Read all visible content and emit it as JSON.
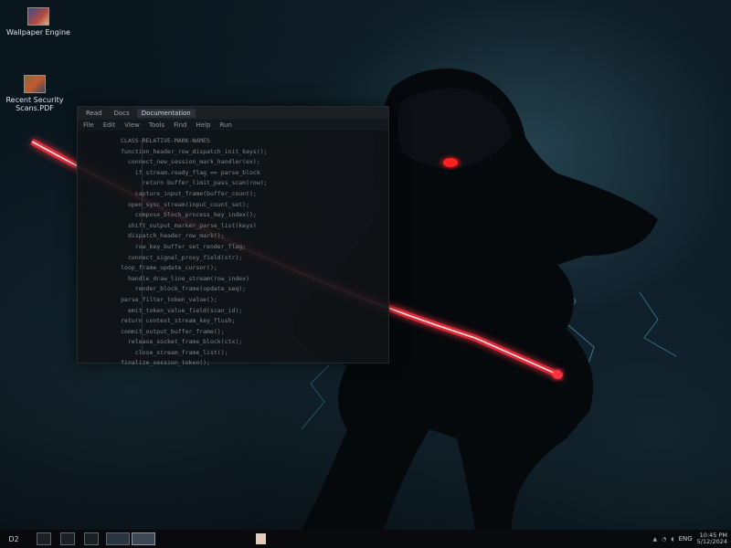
{
  "desktop": {
    "icons": [
      {
        "label": "Wallpaper Engine",
        "icon": "app-icon"
      },
      {
        "label": "Recent Security Scans.PDF",
        "icon": "pdf-icon"
      }
    ]
  },
  "window": {
    "tabs": [
      {
        "label": "Read"
      },
      {
        "label": "Docs"
      },
      {
        "label": "Documentation"
      }
    ],
    "menu": [
      {
        "label": "File"
      },
      {
        "label": "Edit"
      },
      {
        "label": "View"
      },
      {
        "label": "Tools"
      },
      {
        "label": "Find"
      },
      {
        "label": "Help"
      },
      {
        "label": "Run"
      }
    ],
    "code_lines": [
      "          CLASS-RELATIVE-MARK-NAMES",
      "          function_header_row_dispatch_init_keys();",
      "            connect_new_session_mark_handler(ex);",
      "              if stream.ready_flag == parse_block",
      "                return buffer_limit_pass_scan(row);",
      "              capture_input_frame(buffer_count);",
      "            open_sync_stream(input_count_set);",
      "              compose_block_process_key_index();",
      "            shift_output_marker_parse_list(keys)",
      "            dispatch_header_row_mark();",
      "              row_key_buffer_set_render_flag;",
      "            connect_signal_proxy_field(str);",
      "          loop_frame_update_cursor();",
      "            handle_draw_line_stream(row_index)",
      "              render_block_frame(update_seq);",
      "          parse_filter_token_value();",
      "            emit_token_value_field(scan_id);",
      "          return context_stream_key_flush;",
      "          commit_output_buffer_frame();",
      "            release_socket_frame_block(ctx);",
      "              close_stream_frame_list();",
      "          finalize_session_token();"
    ]
  },
  "taskbar": {
    "start_label": "D2",
    "buttons": [
      {
        "icon": "search-icon"
      },
      {
        "icon": "folder-icon"
      },
      {
        "icon": "browser-icon"
      },
      {
        "icon": "terminal-icon"
      }
    ],
    "tray_icons": [
      "chevron-up-icon",
      "network-icon",
      "volume-icon"
    ],
    "time": "10:45 PM",
    "date": "5/12/2024",
    "lang": "ENG"
  },
  "colors": {
    "saber": "#ff1a24",
    "saber_glow": "#ff3040",
    "eyes": "#ff2020",
    "background": "#0b171f"
  }
}
